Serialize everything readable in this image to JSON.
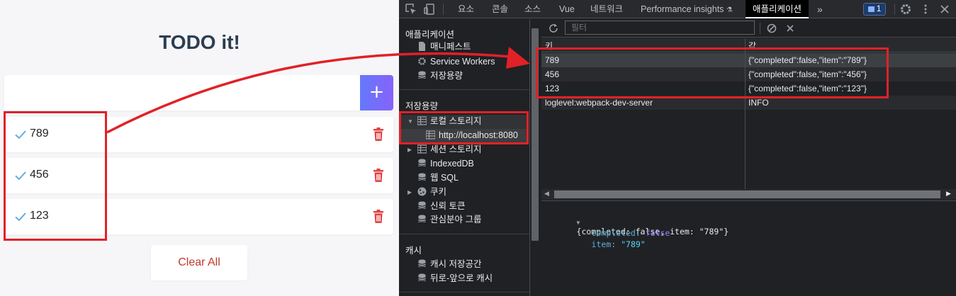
{
  "app": {
    "title": "TODO it!",
    "input_placeholder": "",
    "add_button_label": "+",
    "todos": [
      {
        "text": "789"
      },
      {
        "text": "456"
      },
      {
        "text": "123"
      }
    ],
    "clear_all_label": "Clear All",
    "colors": {
      "title": "#2c3e50",
      "check": "#62acde",
      "trash": "#de4343",
      "add_gradient_start": "#6478fb",
      "add_gradient_end": "#8763fb",
      "clear_text": "#c0392b"
    }
  },
  "devtools": {
    "tabs": [
      {
        "label": "요소"
      },
      {
        "label": "콘솔"
      },
      {
        "label": "소스"
      },
      {
        "label": "Vue"
      },
      {
        "label": "네트워크"
      },
      {
        "label": "Performance insights"
      },
      {
        "label": "애플리케이션"
      }
    ],
    "active_tab": "애플리케이션",
    "more_tabs_label": "»",
    "message_count": "1",
    "sidebar": {
      "application_heading": "애플리케이션",
      "application_items": [
        {
          "label": "매니페스트",
          "icon": "file-icon"
        },
        {
          "label": "Service Workers",
          "icon": "gear-icon"
        },
        {
          "label": "저장용량",
          "icon": "database-icon"
        }
      ],
      "storage_heading": "저장용량",
      "storage_items": [
        {
          "label": "로컬 스토리지",
          "icon": "grid-icon",
          "expanded": true
        },
        {
          "label": "http://localhost:8080",
          "icon": "grid-icon"
        },
        {
          "label": "세션 스토리지",
          "icon": "grid-icon",
          "expanded": false
        },
        {
          "label": "IndexedDB",
          "icon": "database-icon"
        },
        {
          "label": "웹 SQL",
          "icon": "database-icon"
        },
        {
          "label": "쿠키",
          "icon": "cookie-icon",
          "expanded": false
        },
        {
          "label": "신뢰 토큰",
          "icon": "database-icon"
        },
        {
          "label": "관심분야 그룹",
          "icon": "database-icon"
        }
      ],
      "cache_heading": "캐시",
      "cache_items": [
        {
          "label": "캐시 저장공간",
          "icon": "database-icon"
        },
        {
          "label": "뒤로-앞으로 캐시",
          "icon": "database-icon"
        }
      ]
    },
    "filter_placeholder": "필터",
    "table": {
      "columns": [
        "키",
        "값"
      ],
      "rows": [
        {
          "key": "789",
          "value": "{\"completed\":false,\"item\":\"789\"}"
        },
        {
          "key": "456",
          "value": "{\"completed\":false,\"item\":\"456\"}"
        },
        {
          "key": "123",
          "value": "{\"completed\":false,\"item\":\"123\"}"
        },
        {
          "key": "loglevel:webpack-dev-server",
          "value": "INFO"
        }
      ]
    },
    "preview": {
      "summary": "{completed: false, item: \"789\"}",
      "fields": [
        {
          "key": "completed",
          "value": "false"
        },
        {
          "key": "item",
          "value": "\"789\""
        }
      ]
    }
  }
}
